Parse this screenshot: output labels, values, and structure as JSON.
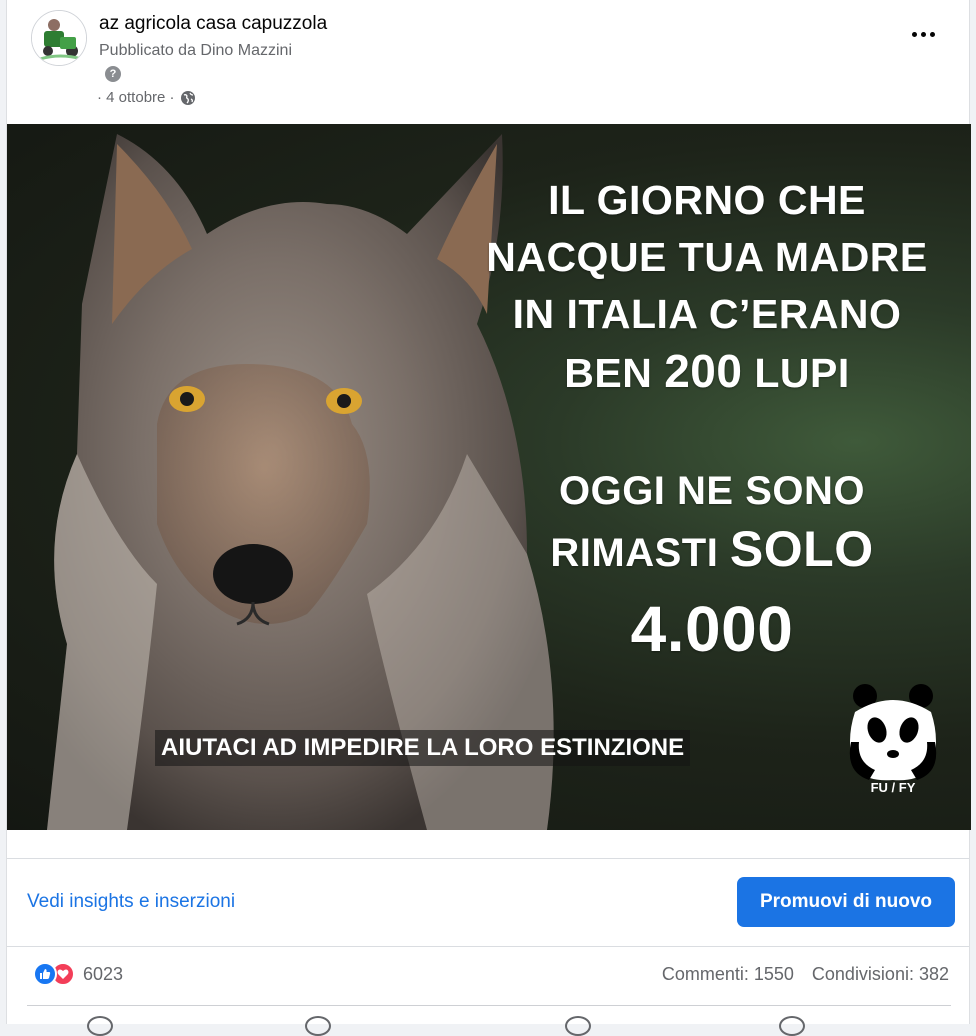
{
  "post": {
    "page_name": "az agricola casa capuzzola",
    "published_prefix": "Pubblicato da",
    "author": "Dino Mazzini",
    "help_glyph": "?",
    "date": "· 4 ottobre ·",
    "menu_icon": "more-horizontal-icon",
    "privacy_icon": "globe-icon"
  },
  "image": {
    "line1": "IL GIORNO CHE",
    "line2": "NACQUE TUA MADRE",
    "line3": "IN ITALIA C’ERANO",
    "line4_a": "BEN ",
    "line4_b": "200",
    "line4_c": " LUPI",
    "line5": "OGGI NE SONO",
    "line6_a": "RIMASTI ",
    "line6_b": "SOLO",
    "line7": "4.000",
    "caption": "AIUTACI AD IMPEDIRE LA LORO ESTINZIONE",
    "logo_text": "FU / FY"
  },
  "actions": {
    "insights_link": "Vedi insights e inserzioni",
    "promote_button": "Promuovi di nuovo"
  },
  "stats": {
    "reaction_count": "6023",
    "comments": "Commenti: 1550",
    "shares": "Condivisioni: 382",
    "reaction_icons": [
      "like-icon",
      "love-icon"
    ]
  },
  "colors": {
    "accent": "#1b74e4",
    "like": "#1877f2",
    "love": "#f33e58",
    "muted_text": "#65676b"
  }
}
